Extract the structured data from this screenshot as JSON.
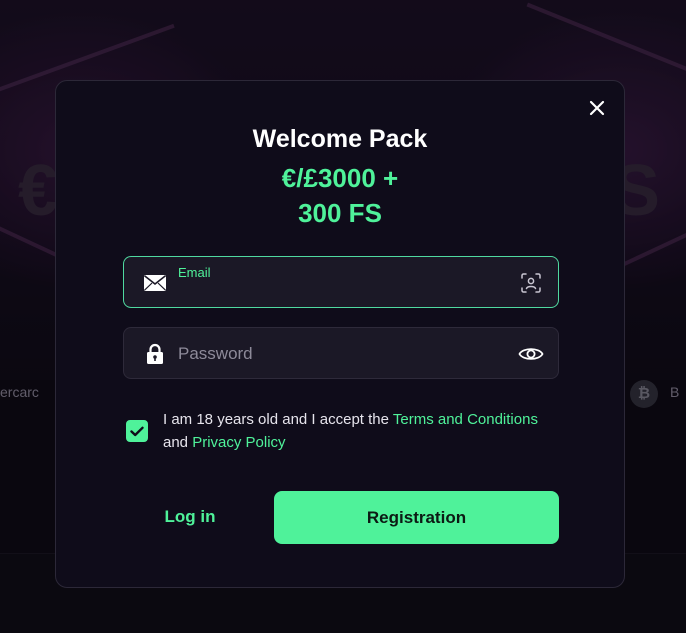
{
  "background": {
    "text_left": "€",
    "text_right": "S",
    "text_small_left": "ercarc",
    "text_small_right": "B",
    "coin_glyph": "₿"
  },
  "modal": {
    "title": "Welcome Pack",
    "offer_line1": "€/£3000 +",
    "offer_line2": "300 FS",
    "close_icon": "close-icon",
    "email": {
      "label": "Email",
      "value": "",
      "icon": "envelope-icon",
      "trailing_icon": "face-id-icon"
    },
    "password": {
      "placeholder": "Password",
      "value": "",
      "icon": "lock-icon",
      "trailing_icon": "eye-icon"
    },
    "consent": {
      "checked": true,
      "text_prefix": "I am 18 years old and I accept the ",
      "terms_link": "Terms and Conditions",
      "text_and": " and ",
      "privacy_link": "Privacy Policy"
    },
    "login_label": "Log in",
    "register_label": "Registration"
  },
  "colors": {
    "accent": "#4ff29a",
    "modal_bg": "#0f0c1a",
    "field_bg": "#1b1826"
  }
}
